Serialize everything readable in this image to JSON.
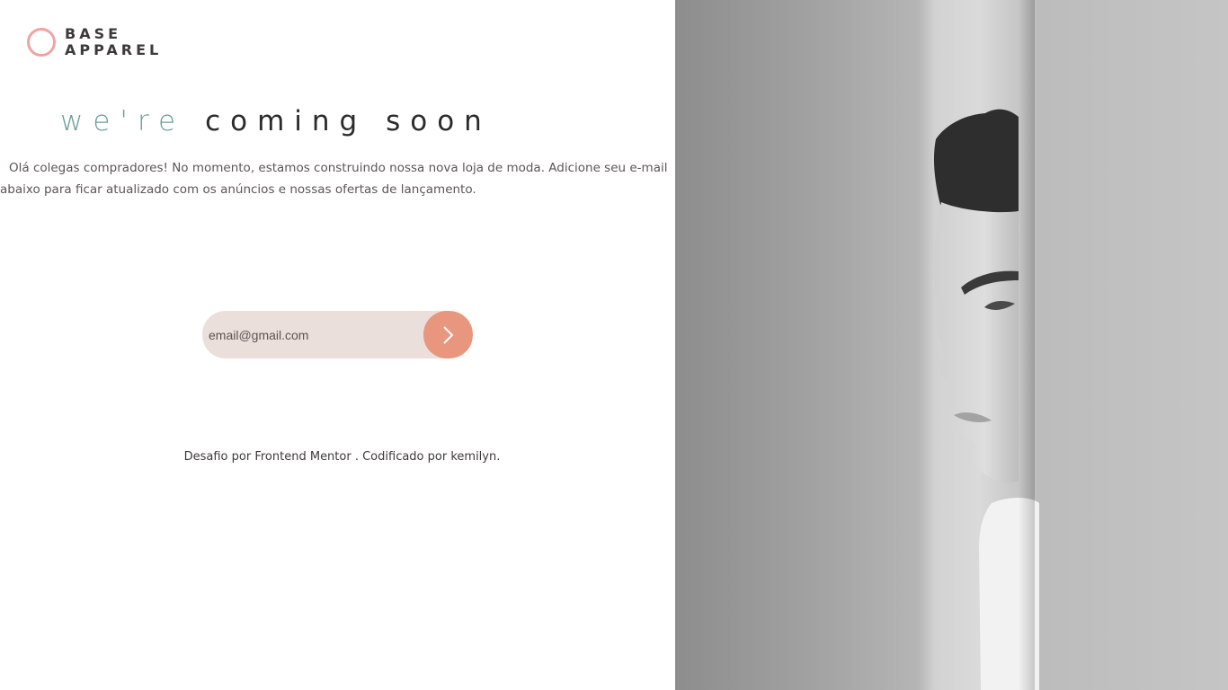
{
  "brand": {
    "line1": "BASE",
    "line2": "APPAREL"
  },
  "headline": {
    "light": "we're",
    "dark": "coming soon"
  },
  "description": {
    "line1": "Olá colegas compradores! No momento, estamos construindo nossa nova loja de moda. Adicione seu e-mail",
    "line2": "abaixo para ficar atualizado com os anúncios e nossas ofertas de lançamento."
  },
  "form": {
    "email_value": "email@gmail.com",
    "submit_icon": "chevron-right-icon"
  },
  "footer": {
    "prefix": "Desafio por",
    "link1": "Frontend Mentor",
    "middle": ". Codificado por",
    "link2": "kemilyn",
    "suffix": "."
  },
  "colors": {
    "accent": "#e9967e",
    "logo_ring": "#f0a3a3",
    "headline_light": "#6a9e99",
    "input_bg": "#ebdfdc"
  }
}
